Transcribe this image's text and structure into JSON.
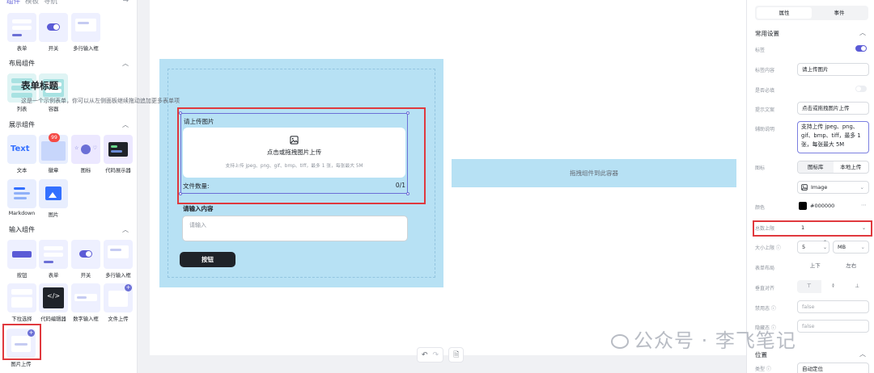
{
  "left": {
    "tabs": [
      "组件",
      "模板",
      "导航"
    ],
    "more": "⇆",
    "row0": [
      "表单",
      "开关",
      "多行输入框"
    ],
    "layout": {
      "title": "布局组件",
      "items": [
        "列表",
        "容器"
      ]
    },
    "display": {
      "title": "展示组件",
      "items": [
        "文本",
        "徽章",
        "图标",
        "代码展示器",
        "Markdown",
        "图片"
      ],
      "text_thumb": "Text",
      "badge": "99"
    },
    "input": {
      "title": "输入组件",
      "items": [
        "按钮",
        "表单",
        "开关",
        "多行输入框",
        "下拉选择",
        "代码编辑器",
        "数字输入框",
        "文件上传",
        "图片上传"
      ]
    }
  },
  "canvas": {
    "form_title": "表单标题",
    "form_desc": "这是一个示例表单，你可以从左侧面板继续拖动追加更多表单项",
    "upload": {
      "label": "请上传图片",
      "main": "点击或拖拽图片上传",
      "sub": "支持上传 jpeg、png、gif、bmp、tiff，最多 1 张，每张最大 5M",
      "count_label": "文件数量:",
      "count_value": "0/1"
    },
    "input": {
      "label": "请输入内容",
      "placeholder": "请输入"
    },
    "button": "按钮",
    "drop_zone": "拖拽组件到此容器",
    "tools": [
      "↶",
      "↷",
      "🗎"
    ]
  },
  "right": {
    "tabs": [
      "属性",
      "事件"
    ],
    "section": "常用设置",
    "props": {
      "label": "标签",
      "label_content_lbl": "标签内容",
      "label_content": "请上传图片",
      "required": "是否必填",
      "hint_lbl": "提示文案",
      "hint": "点击或拖拽图片上传",
      "aux_lbl": "辅助说明",
      "aux": "支持上传 jpeg、png、gif、bmp、tiff，最多 1 张，每张最大 5M",
      "icon_lbl": "图标",
      "icon_tabs": [
        "图标库",
        "本地上传"
      ],
      "icon_value": "Image",
      "color_lbl": "颜色",
      "color_value": "#000000",
      "total_lbl": "总数上限",
      "total_value": "1",
      "size_lbl": "大小上限",
      "size_value": "5",
      "size_unit": "MB",
      "layout_lbl": "表单布局",
      "layout_opts": [
        "上下",
        "左右"
      ],
      "valign_lbl": "垂直对齐",
      "disabled_lbl": "禁用态",
      "disabled_value": "false",
      "hidden_lbl": "隐藏态",
      "hidden_value": "false"
    },
    "position_section": "位置",
    "type_lbl": "类型",
    "type_value": "自动定位"
  },
  "watermark": "公众号 · 李飞笔记"
}
